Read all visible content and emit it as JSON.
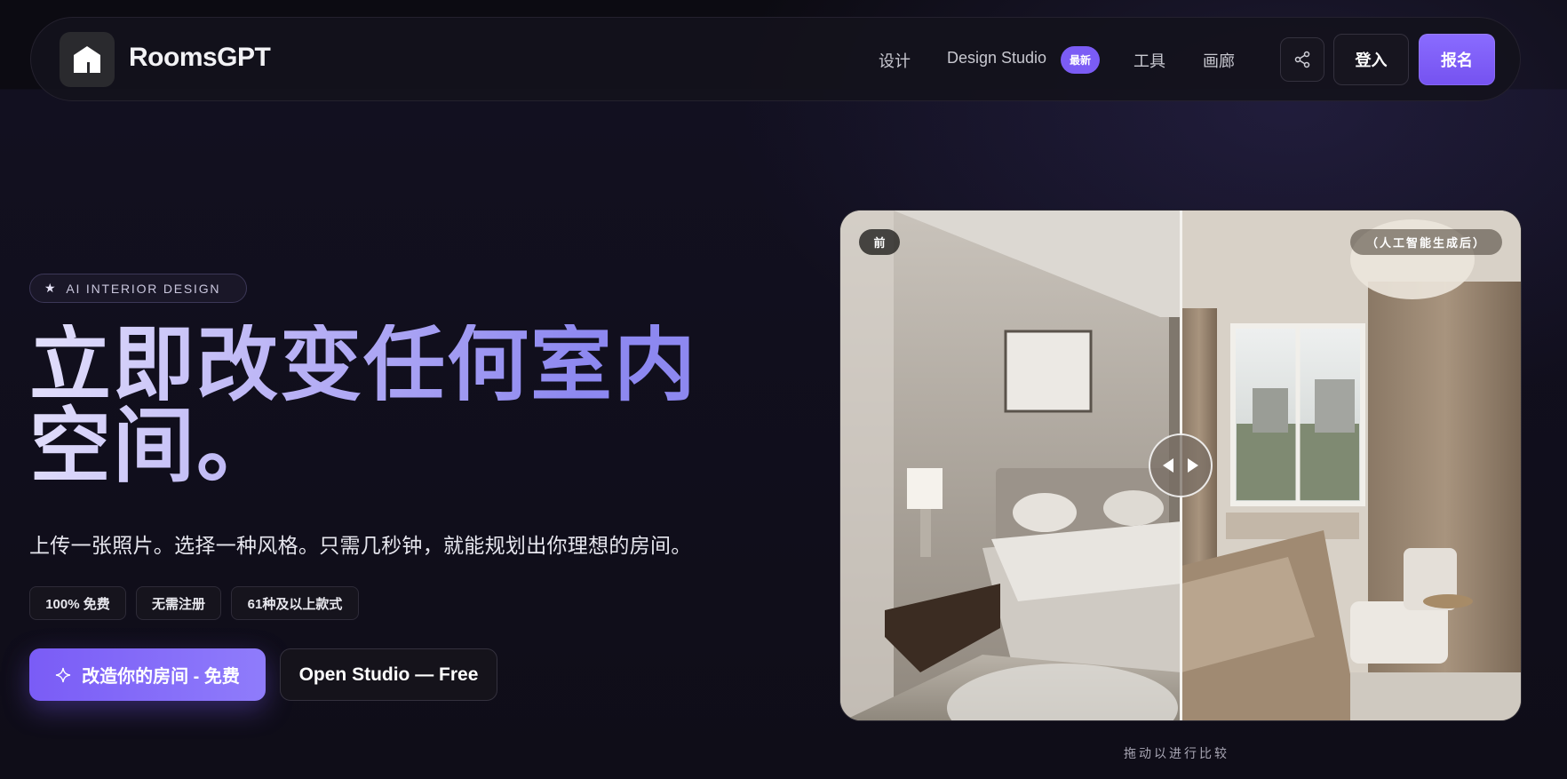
{
  "nav": {
    "brand": "RoomsGPT",
    "links": [
      {
        "label": "设计"
      },
      {
        "label": "Design Studio",
        "badge": "最新"
      },
      {
        "label": "工具"
      },
      {
        "label": "画廊"
      }
    ],
    "login_label": "登入",
    "signup_label": "报名"
  },
  "hero": {
    "eyebrow": "AI INTERIOR DESIGN",
    "headline_line1": "立即改变任何室内",
    "headline_line2": "空间。",
    "subline": "上传一张照片。选择一种风格。只需几秒钟，就能规划出你理想的房间。",
    "chips": [
      "100% 免费",
      "无需注册",
      "61种及以上款式"
    ],
    "cta_primary": "改造你的房间 - 免费",
    "cta_secondary": "Open Studio — Free"
  },
  "compare": {
    "before_label": "前",
    "after_label": "（人工智能生成后）",
    "hint": "拖动以进行比较"
  },
  "colors": {
    "accent": "#7b5cf5",
    "background": "#0f0d17"
  },
  "icons": {
    "logo": "house-icon",
    "share": "share-icon",
    "eyebrow": "star-icon",
    "cta": "sparkle-icon",
    "handle": "arrows-left-right-icon"
  }
}
